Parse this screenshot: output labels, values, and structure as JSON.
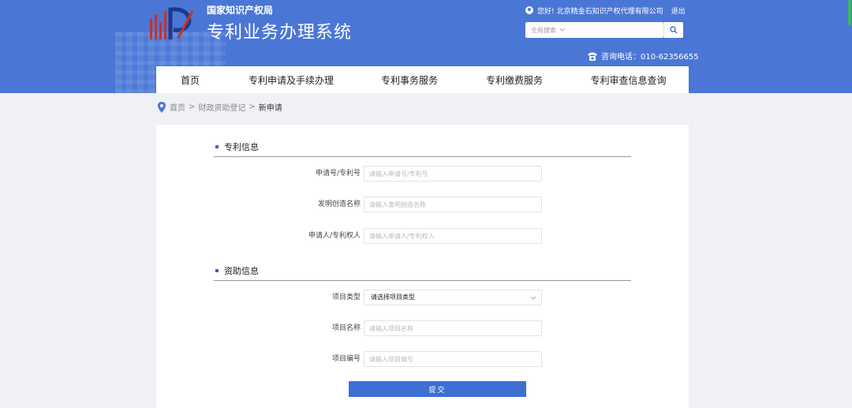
{
  "header": {
    "org_name": "国家知识产权局",
    "system_title": "专利业务办理系统",
    "greeting": "您好!",
    "company": "北京精金石知识产权代理有限公司",
    "logout": "退出",
    "search": {
      "placeholder": "全局搜索",
      "scope_icon": "chevron-down-icon"
    },
    "hotline": "咨询电话：010-62356655"
  },
  "nav": {
    "items": [
      {
        "label": "首页"
      },
      {
        "label": "专利申请及手续办理"
      },
      {
        "label": "专利事务服务"
      },
      {
        "label": "专利缴费服务"
      },
      {
        "label": "专利审查信息查询"
      }
    ]
  },
  "breadcrumb": {
    "home": "首页",
    "sep": ">",
    "parent": "财政资助登记",
    "current": "新申请"
  },
  "form": {
    "patent_section": "专利信息",
    "patent_fields": [
      {
        "label": "申请号/专利号",
        "placeholder": "请输入申请号/专利号"
      },
      {
        "label": "发明创造名称",
        "placeholder": "请输入发明创造名称"
      },
      {
        "label": "申请人/专利权人",
        "placeholder": "请输入申请人/专利权人"
      }
    ],
    "funding_section": "资助信息",
    "project_type": {
      "label": "项目类型",
      "selected": "请选择项目类型"
    },
    "funding_fields": [
      {
        "label": "项目名称",
        "placeholder": "请输入项目名称"
      },
      {
        "label": "项目编号",
        "placeholder": "请输入项目编号"
      }
    ],
    "submit": "提交"
  },
  "colors": {
    "header_bg": "#4a77d6",
    "accent": "#3f6fd3",
    "page_bg": "#f0f1f4"
  }
}
